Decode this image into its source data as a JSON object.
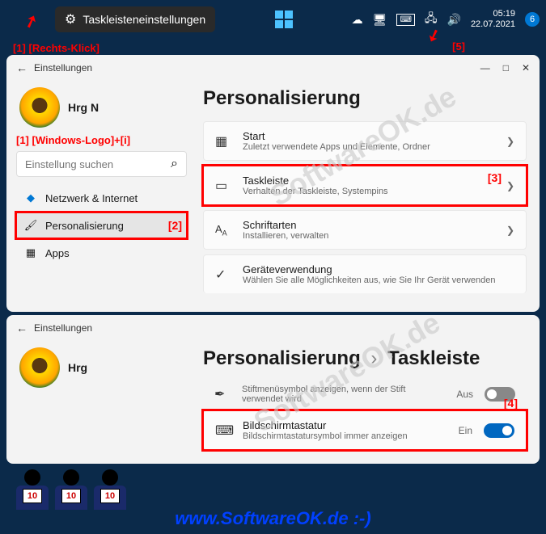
{
  "taskbar": {
    "context_menu": "Taskleisteneinstellungen",
    "time": "05:19",
    "date": "22.07.2021",
    "notif_count": "6"
  },
  "annotations": {
    "a1": "[1]  [Rechts-Klick]",
    "a1b": "[1] [Windows-Logo]+[i]",
    "n2": "[2]",
    "n3": "[3]",
    "n4": "[4]",
    "n5": "[5]"
  },
  "window1": {
    "back_title": "Einstellungen",
    "profile_name": "Hrg N",
    "search_placeholder": "Einstellung suchen",
    "nav": {
      "network": "Netzwerk & Internet",
      "personalization": "Personalisierung",
      "apps": "Apps"
    },
    "page_title": "Personalisierung",
    "cards": {
      "start": {
        "title": "Start",
        "sub": "Zuletzt verwendete Apps und Elemente, Ordner"
      },
      "taskbar": {
        "title": "Taskleiste",
        "sub": "Verhalten der Taskleiste, Systempins"
      },
      "fonts": {
        "title": "Schriftarten",
        "sub": "Installieren, verwalten"
      },
      "device": {
        "title": "Geräteverwendung",
        "sub": "Wählen Sie alle Möglichkeiten aus, wie Sie Ihr Gerät verwenden"
      }
    }
  },
  "window2": {
    "back_title": "Einstellungen",
    "profile_name": "Hrg",
    "breadcrumb": {
      "p1": "Personalisierung",
      "p2": "Taskleiste"
    },
    "pen": {
      "title": "Stiftmenüsymbol anzeigen, wenn der Stift verwendet wird",
      "state": "Aus"
    },
    "keyboard": {
      "title": "Bildschirmtastatur",
      "sub": "Bildschirmtastatursymbol immer anzeigen",
      "state": "Ein"
    }
  },
  "footer": "www.SoftwareOK.de :-)",
  "watermark": "SoftwareOK.de",
  "judge_score": "10"
}
